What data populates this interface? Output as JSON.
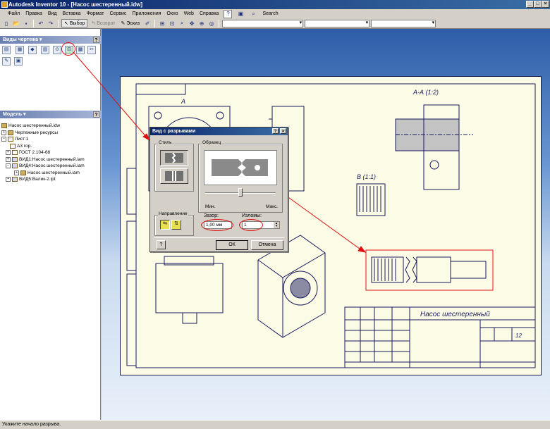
{
  "window": {
    "title": "Autodesk Inventor 10 - [Насос шестеренный.idw]"
  },
  "menu": [
    "Файл",
    "Правка",
    "Вид",
    "Вставка",
    "Формат",
    "Сервис",
    "Приложения",
    "Окно",
    "Web",
    "Справка"
  ],
  "toolbar": {
    "select_label": "Выбор",
    "return_label": "Возврат",
    "sketch_label": "Эскиз",
    "search_label": "Search"
  },
  "drawing_views_panel": {
    "title": "Виды чертежа"
  },
  "model_panel": {
    "title": "Модель",
    "tree": [
      {
        "label": "Насос шестеренный.idw",
        "level": 0
      },
      {
        "label": "Чертежные ресурсы",
        "level": 0
      },
      {
        "label": "Лист:1",
        "level": 0
      },
      {
        "label": "А3 гор.",
        "level": 1
      },
      {
        "label": "ГОСТ 2.104-68",
        "level": 1
      },
      {
        "label": "ВИД1:Насос шестеренный.iam",
        "level": 1
      },
      {
        "label": "ВИД4:Насос шестеренный.iam",
        "level": 1
      },
      {
        "label": "Насос шестеренный.iam",
        "level": 2
      },
      {
        "label": "ВИД5:Валик-2.ipt",
        "level": 1
      }
    ]
  },
  "dialog": {
    "title": "Вид с разрывами",
    "style_label": "Стиль",
    "sample_label": "Образец",
    "min_label": "Мин.",
    "max_label": "Макс.",
    "direction_label": "Направление",
    "gap_label": "Зазор:",
    "gap_value": "1,00 мм",
    "breaks_label": "Изломы:",
    "breaks_value": "1",
    "ok_label": "ОК",
    "cancel_label": "Отмена",
    "slider_level": 0.5
  },
  "drawing": {
    "section_label": "А-А (1:2)",
    "detail_label": "В (1:1)",
    "view_a_label": "А",
    "title_block_name": "Насос шестеренный",
    "sheet_number": "12"
  },
  "status": {
    "text": "Укажите начало разрыва."
  },
  "colors": {
    "annotation": "#e01010",
    "line": "#1a1a60",
    "sheet": "#fbfbe6"
  }
}
